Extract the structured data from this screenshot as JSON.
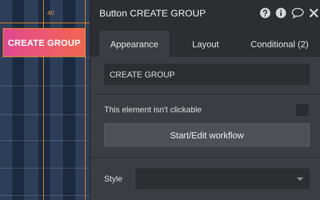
{
  "canvas": {
    "ruler_number": "40",
    "button_preview_label": "CREATE GROUP",
    "button_gradient": [
      "#e0488f",
      "#f0654f"
    ],
    "guide_color": "#f08a24"
  },
  "editor": {
    "title": "Button CREATE GROUP",
    "title_icons": [
      "help-icon",
      "info-icon",
      "comment-icon",
      "close-icon"
    ],
    "tabs": [
      {
        "label": "Appearance",
        "active": true
      },
      {
        "label": "Layout",
        "active": false
      },
      {
        "label": "Conditional (2)",
        "active": false
      }
    ],
    "text_value": "CREATE GROUP",
    "not_clickable_label": "This element isn't clickable",
    "not_clickable_checked": false,
    "workflow_button_label": "Start/Edit workflow",
    "style_label": "Style",
    "style_value": ""
  }
}
